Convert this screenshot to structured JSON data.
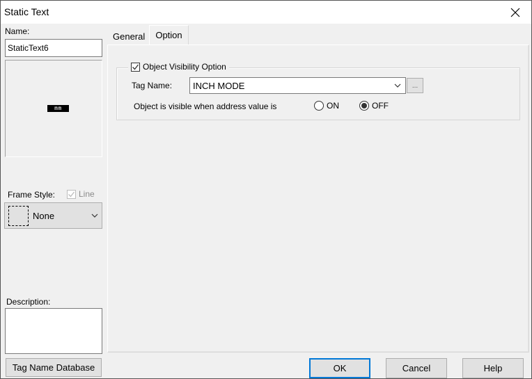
{
  "window": {
    "title": "Static Text"
  },
  "left": {
    "name_label": "Name:",
    "name_value": "StaticText6",
    "preview_text": "mm",
    "frame_style_label": "Frame Style:",
    "line_label": "Line",
    "line_checked": true,
    "line_enabled": false,
    "frame_style_value": "None",
    "description_label": "Description:",
    "description_value": "",
    "tag_db_button": "Tag Name Database"
  },
  "tabs": [
    {
      "label": "General",
      "active": false
    },
    {
      "label": "Option",
      "active": true
    }
  ],
  "option": {
    "visibility_label": "Object Visibility Option",
    "visibility_checked": true,
    "tag_name_label": "Tag Name:",
    "tag_name_value": "INCH MODE",
    "browse_button": "...",
    "visible_when_label": "Object is visible when address value is",
    "radio_on_label": "ON",
    "radio_off_label": "OFF",
    "selected": "OFF"
  },
  "footer": {
    "ok": "OK",
    "cancel": "Cancel",
    "help": "Help"
  }
}
